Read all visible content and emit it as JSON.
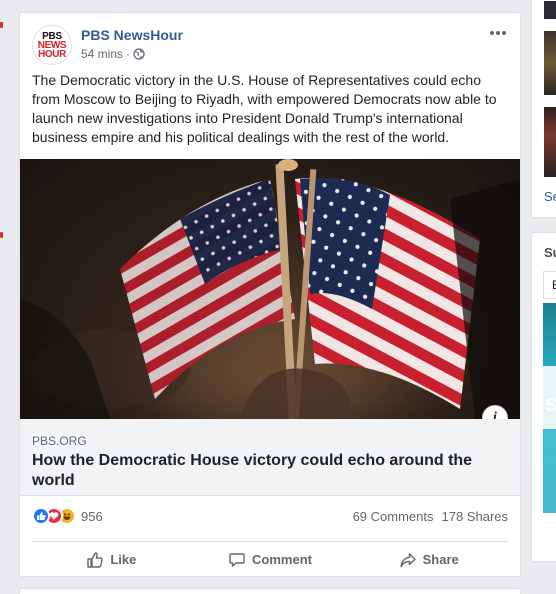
{
  "post": {
    "page_name": "PBS NewsHour",
    "timestamp": "54 mins",
    "privacy_separator": "·",
    "logo": {
      "line1": "PBS",
      "line2": "NEWS",
      "line3": "HOUR"
    },
    "text": "The Democratic victory in the U.S. House of Representatives could echo from Moscow to Beijing to Riyadh, with empowered Democrats now able to launch new investigations into President Donald Trump's international business empire and his political dealings with the rest of the world.",
    "link": {
      "domain": "PBS.ORG",
      "title": "How the Democratic House victory could echo around the world"
    },
    "info_icon_label": "i",
    "reactions_count": "956",
    "comments": "69 Comments",
    "shares": "178 Shares",
    "actions": {
      "like": "Like",
      "comment": "Comment",
      "share": "Share"
    }
  },
  "right_column": {
    "see_link": "Se",
    "section_title": "Su",
    "inner_letter": "E",
    "ad_text": "S"
  },
  "colors": {
    "page_name": "#385898",
    "like_blue": "#2078f4",
    "love_red": "#f0284a",
    "haha_yellow": "#f7b125",
    "pbs_red": "#d62027"
  },
  "icons": [
    "globe-icon",
    "more-options-icon",
    "like-reaction-icon",
    "love-reaction-icon",
    "haha-reaction-icon",
    "thumbs-up-icon",
    "comment-icon",
    "share-icon",
    "info-icon"
  ]
}
